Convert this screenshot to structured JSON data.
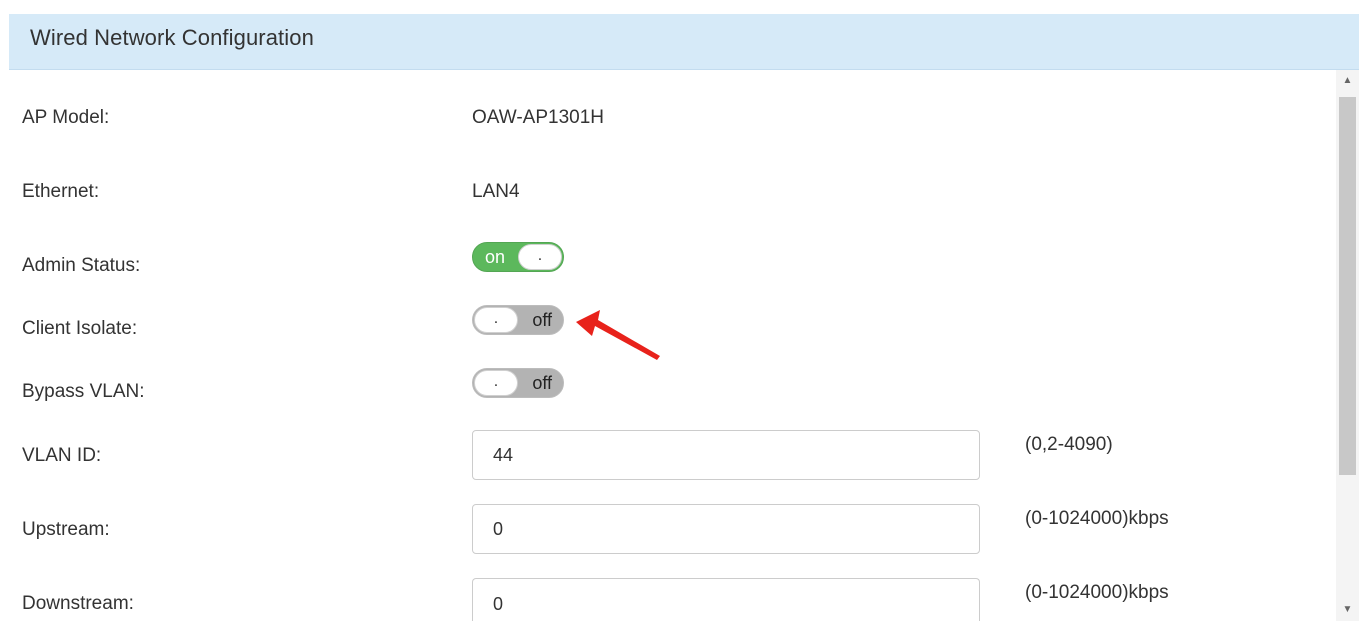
{
  "header": {
    "title": "Wired Network Configuration"
  },
  "form": {
    "ap_model": {
      "label": "AP Model:",
      "value": "OAW-AP1301H"
    },
    "ethernet": {
      "label": "Ethernet:",
      "value": "LAN4"
    },
    "admin_status": {
      "label": "Admin Status:",
      "state": "on",
      "state_text": "on",
      "knob_text": "."
    },
    "client_isolate": {
      "label": "Client Isolate:",
      "state": "off",
      "state_text": "off",
      "knob_text": "."
    },
    "bypass_vlan": {
      "label": "Bypass VLAN:",
      "state": "off",
      "state_text": "off",
      "knob_text": "."
    },
    "vlan_id": {
      "label": "VLAN ID:",
      "value": "44",
      "hint": "(0,2-4090)"
    },
    "upstream": {
      "label": "Upstream:",
      "value": "0",
      "hint": "(0-1024000)kbps"
    },
    "downstream": {
      "label": "Downstream:",
      "value": "0",
      "hint": "(0-1024000)kbps"
    }
  },
  "annotation": {
    "arrow_color": "#e8221b",
    "points_to": "client-isolate-toggle"
  },
  "colors": {
    "header_bg": "#d6eaf8",
    "toggle_on": "#5cb85c",
    "toggle_off": "#b3b3b3"
  },
  "scrollbar": {
    "up_icon": "triangle-up",
    "down_icon": "triangle-down"
  }
}
